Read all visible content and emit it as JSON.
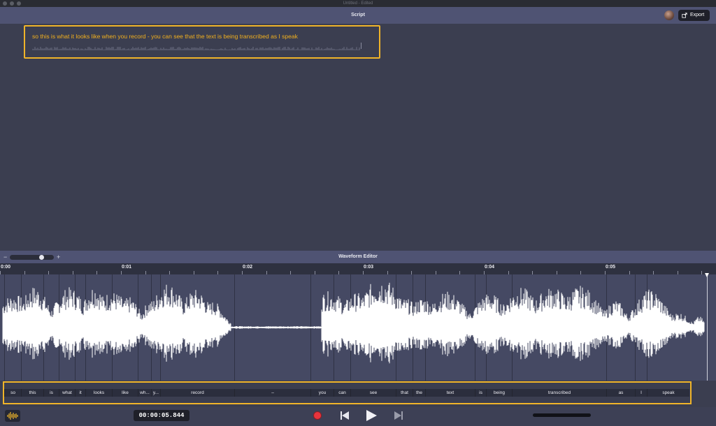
{
  "window": {
    "title": "Untitled - Edited"
  },
  "script_panel": {
    "title": "Script",
    "export_label": "Export",
    "transcript": "so this is what it looks like when you record - you can see that the text is being transcribed as I speak"
  },
  "waveform_editor": {
    "title": "Waveform Editor",
    "zoom_minus": "−",
    "zoom_plus": "+",
    "ruler": [
      "0:00",
      "0:01",
      "0:02",
      "0:03",
      "0:04",
      "0:05"
    ],
    "words": [
      "so",
      "this",
      "is",
      "what",
      "it",
      "looks",
      "like",
      "wh...",
      "y...",
      "record",
      "–",
      "you",
      "can",
      "see",
      "that",
      "the",
      "text",
      "is",
      "being",
      "transcribed",
      "as",
      "I",
      "speak"
    ]
  },
  "transport": {
    "timecode": "00:00:05.844"
  },
  "colors": {
    "highlight": "#f0b429",
    "transcript_text": "#f2b01e",
    "record": "#e8343d",
    "panel_header": "#4f5373",
    "waveform": "#ffffff"
  },
  "icons": [
    "export-icon",
    "waveform-toggle-icon",
    "record-icon",
    "skip-back-icon",
    "play-icon",
    "skip-forward-icon",
    "zoom-slider-knob"
  ]
}
